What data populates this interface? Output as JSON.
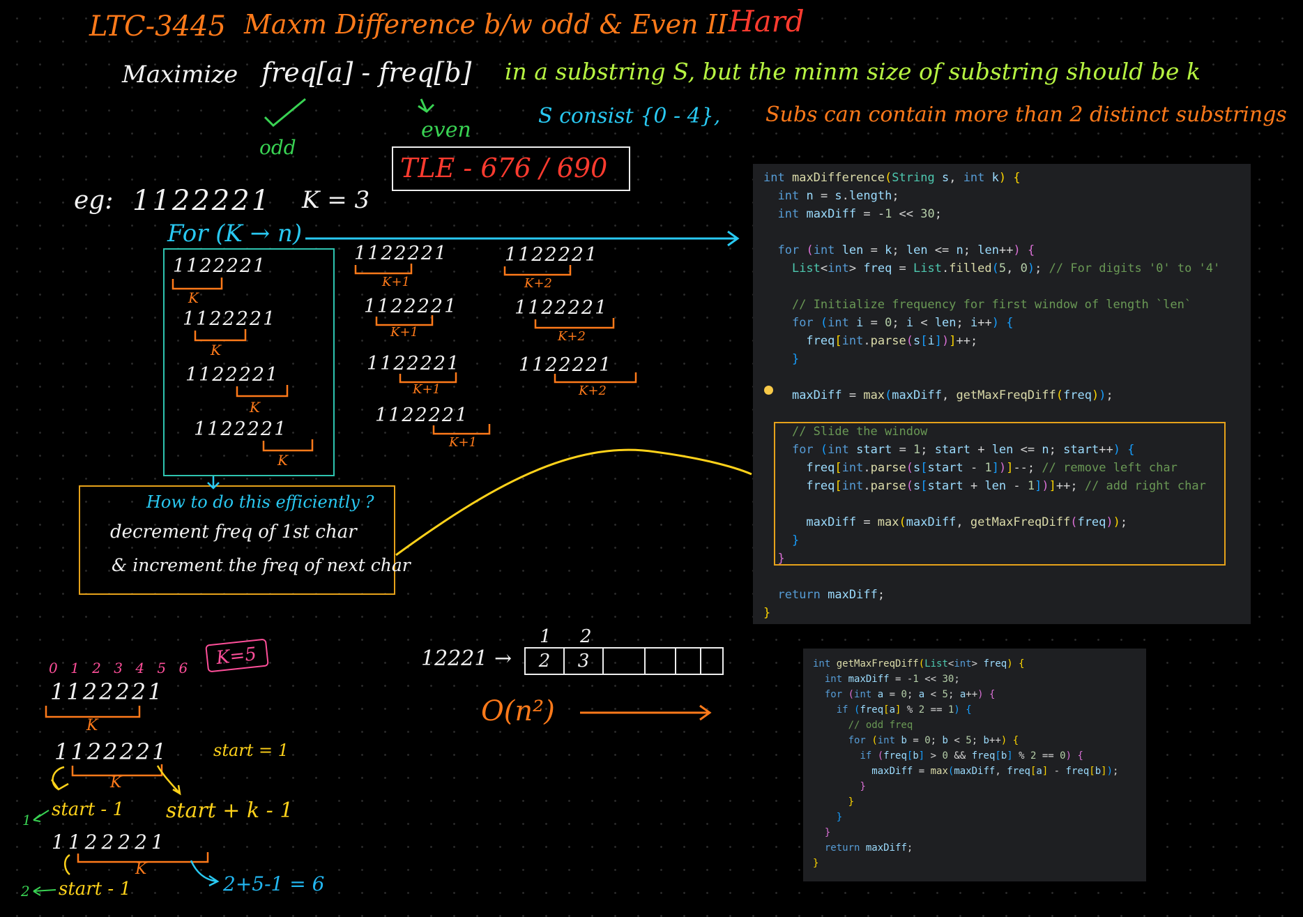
{
  "header": {
    "problem_id": "LTC-3445",
    "title": "Maxm Difference b/w odd & Even II",
    "difficulty": "Hard"
  },
  "statement": {
    "maximize_label": "Maximize",
    "expression": "freq[a] - freq[b]",
    "odd_note": "odd",
    "even_note": "even",
    "condition": "in a substring S, but the minm size of substring should be k",
    "constraint_s": "S consist {0 - 4},",
    "constraint_sub": "Subs can contain more than 2 distinct substrings"
  },
  "tle_badge": "TLE - 676 / 690",
  "example": {
    "eg_label": "eg:",
    "string": "1122221",
    "k_label": "K = 3",
    "loop_label": "For (K → n)",
    "windows_col1": [
      "1122221",
      "1122221",
      "1122221",
      "1122221"
    ],
    "windows_col1_mark": "K",
    "windows_col2": [
      "1122221",
      "1122221",
      "1122221",
      "1122221"
    ],
    "windows_col2_mark": "K+1",
    "windows_col3": [
      "1122221",
      "1122221",
      "1122221"
    ],
    "windows_col3_mark": "K+2"
  },
  "efficiency_box": {
    "question": "How to do this efficiently ?",
    "line1": "decrement freq of 1st char",
    "line2": "& increment the freq of next char"
  },
  "walkthrough": {
    "indices": "0 1  2 3 4 5  6",
    "k_note": "K=5",
    "strings": [
      "1122221",
      "1122221",
      "1122221"
    ],
    "k_mark": "K",
    "start_eq": "start = 1",
    "start_minus": "start - 1",
    "start_plus": "start + k - 1",
    "left_idx1": "1",
    "left_idx2": "2",
    "start_minus2": "start - 1",
    "sum_eq": "2+5-1 = 6"
  },
  "array_demo": {
    "input": "12221 →",
    "top_labels": [
      "1",
      "2"
    ],
    "cells": [
      "2",
      "3",
      "",
      "",
      "",
      ""
    ],
    "complexity": "O(n²)"
  },
  "main_code": {
    "lines": [
      "int maxDifference(String s, int k) {",
      "  int n = s.length;",
      "  int maxDiff = -1 << 30;",
      "",
      "  for (int len = k; len <= n; len++) {",
      "    List<int> freq = List.filled(5, 0); // For digits '0' to '4'",
      "",
      "    // Initialize frequency for first window of length `len`",
      "    for (int i = 0; i < len; i++) {",
      "      freq[int.parse(s[i])]++;",
      "    }",
      "",
      "    maxDiff = max(maxDiff, getMaxFreqDiff(freq));",
      "",
      "    // Slide the window",
      "    for (int start = 1; start + len <= n; start++) {",
      "      freq[int.parse(s[start - 1])]--; // remove left char",
      "      freq[int.parse(s[start + len - 1])]++; // add right char",
      "",
      "      maxDiff = max(maxDiff, getMaxFreqDiff(freq));",
      "    }",
      "  }",
      "",
      "  return maxDiff;",
      "}"
    ]
  },
  "helper_code": {
    "lines": [
      "int getMaxFreqDiff(List<int> freq) {",
      "  int maxDiff = -1 << 30;",
      "  for (int a = 0; a < 5; a++) {",
      "    if (freq[a] % 2 == 1) {",
      "      // odd freq",
      "      for (int b = 0; b < 5; b++) {",
      "        if (freq[b] > 0 && freq[b] % 2 == 0) {",
      "          maxDiff = max(maxDiff, freq[a] - freq[b]);",
      "        }",
      "      }",
      "    }",
      "  }",
      "  return maxDiff;",
      "}"
    ]
  },
  "colors": {
    "background": "#000000",
    "title_orange": "#ff7a1a",
    "hard_red": "#ff3b2f",
    "lime": "#b7f542",
    "cyan": "#29c9f2",
    "yellow": "#ffd21a",
    "code_bg": "#1e1f22",
    "highlight_box": "#e6a21a"
  }
}
